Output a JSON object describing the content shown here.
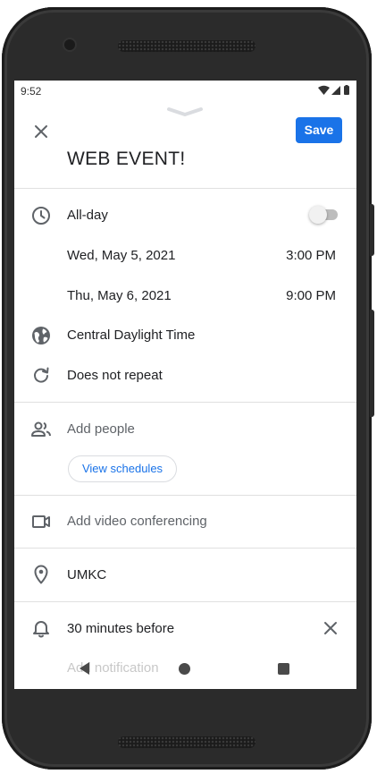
{
  "status_bar": {
    "time": "9:52"
  },
  "toolbar": {
    "save_label": "Save"
  },
  "event": {
    "title": "WEB EVENT!"
  },
  "all_day": {
    "label": "All-day",
    "enabled": false
  },
  "start": {
    "date": "Wed, May 5, 2021",
    "time": "3:00 PM"
  },
  "end": {
    "date": "Thu, May 6, 2021",
    "time": "9:00 PM"
  },
  "timezone": {
    "label": "Central Daylight Time"
  },
  "repeat": {
    "label": "Does not repeat"
  },
  "people": {
    "placeholder": "Add people",
    "view_schedules_label": "View schedules"
  },
  "video": {
    "placeholder": "Add video conferencing"
  },
  "location": {
    "value": "UMKC"
  },
  "notification": {
    "label": "30 minutes before",
    "add_label": "Add notification"
  },
  "icons": [
    "chevron-down-icon",
    "close-icon",
    "clock-icon",
    "globe-icon",
    "repeat-icon",
    "people-icon",
    "video-camera-icon",
    "location-pin-icon",
    "bell-icon",
    "wifi-icon",
    "signal-icon",
    "battery-icon"
  ],
  "colors": {
    "accent": "#1a73e8",
    "text": "#202124",
    "muted": "#5f6368",
    "divider": "#e0e0e0"
  }
}
